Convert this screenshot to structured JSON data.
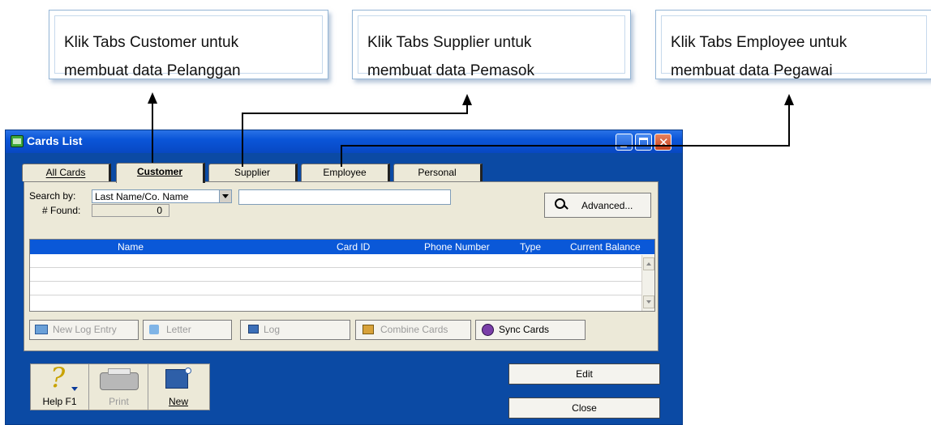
{
  "callouts": [
    {
      "line1": "Klik Tabs Customer untuk",
      "line2": "membuat data Pelanggan"
    },
    {
      "line1": "Klik Tabs Supplier untuk",
      "line2": "membuat data Pemasok"
    },
    {
      "line1": "Klik Tabs Employee untuk",
      "line2": "membuat data Pegawai"
    }
  ],
  "window": {
    "title": "Cards List"
  },
  "tabs": [
    "All Cards",
    "Customer",
    "Supplier",
    "Employee",
    "Personal"
  ],
  "search": {
    "label": "Search by:",
    "selected": "Last Name/Co. Name",
    "value": "",
    "found_label": "# Found:",
    "found_count": "0",
    "advanced_label": "Advanced..."
  },
  "table": {
    "columns": [
      "Name",
      "Card ID",
      "Phone Number",
      "Type",
      "Current Balance"
    ],
    "rows": []
  },
  "actions": [
    "New Log Entry",
    "Letter",
    "Log",
    "Combine Cards",
    "Sync Cards"
  ],
  "footer": {
    "help": "Help F1",
    "print": "Print",
    "new": "New",
    "edit": "Edit",
    "close": "Close"
  },
  "colors": {
    "titlebar": "#0a55d8",
    "window_body": "#0b4aa4",
    "panel": "#ece9d8",
    "table_header": "#0a58d8"
  }
}
